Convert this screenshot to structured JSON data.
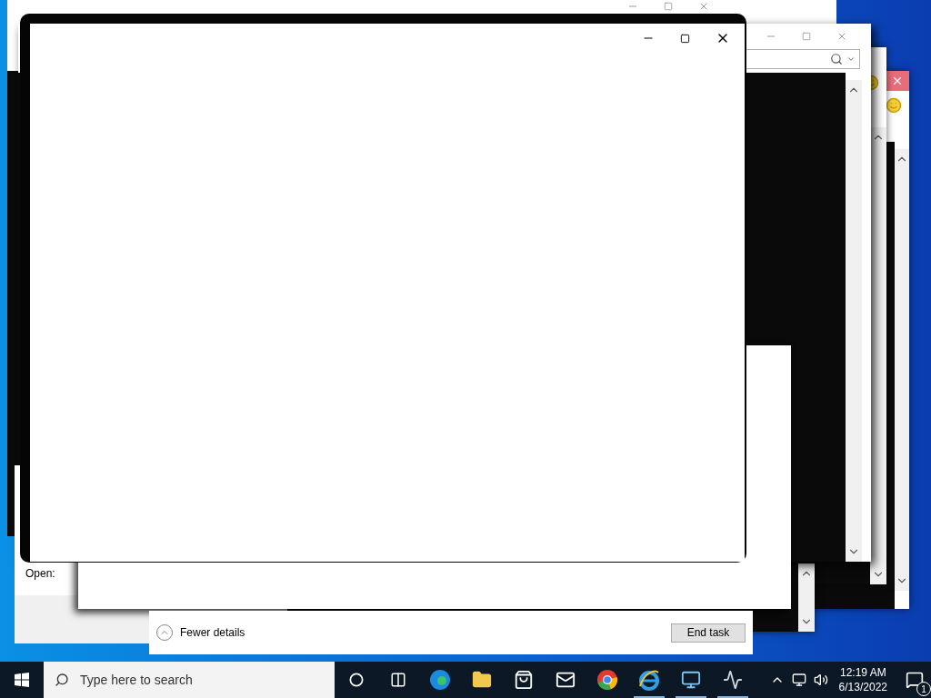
{
  "run_dialog": {
    "field_label": "Open:"
  },
  "task_manager": {
    "details_toggle": "Fewer details",
    "end_task_button": "End task"
  },
  "taskbar": {
    "search_placeholder": "Type here to search",
    "apps": [
      {
        "kind": "cortana",
        "running": false
      },
      {
        "kind": "task-view",
        "running": false
      },
      {
        "kind": "edge",
        "running": false
      },
      {
        "kind": "folder",
        "running": false
      },
      {
        "kind": "store",
        "running": false
      },
      {
        "kind": "mail",
        "running": false
      },
      {
        "kind": "chrome",
        "running": false
      },
      {
        "kind": "ie",
        "running": true
      },
      {
        "kind": "remote",
        "running": true
      },
      {
        "kind": "monitor",
        "running": true
      }
    ],
    "time": "12:19 AM",
    "date": "6/13/2022",
    "notification_count": "1"
  }
}
